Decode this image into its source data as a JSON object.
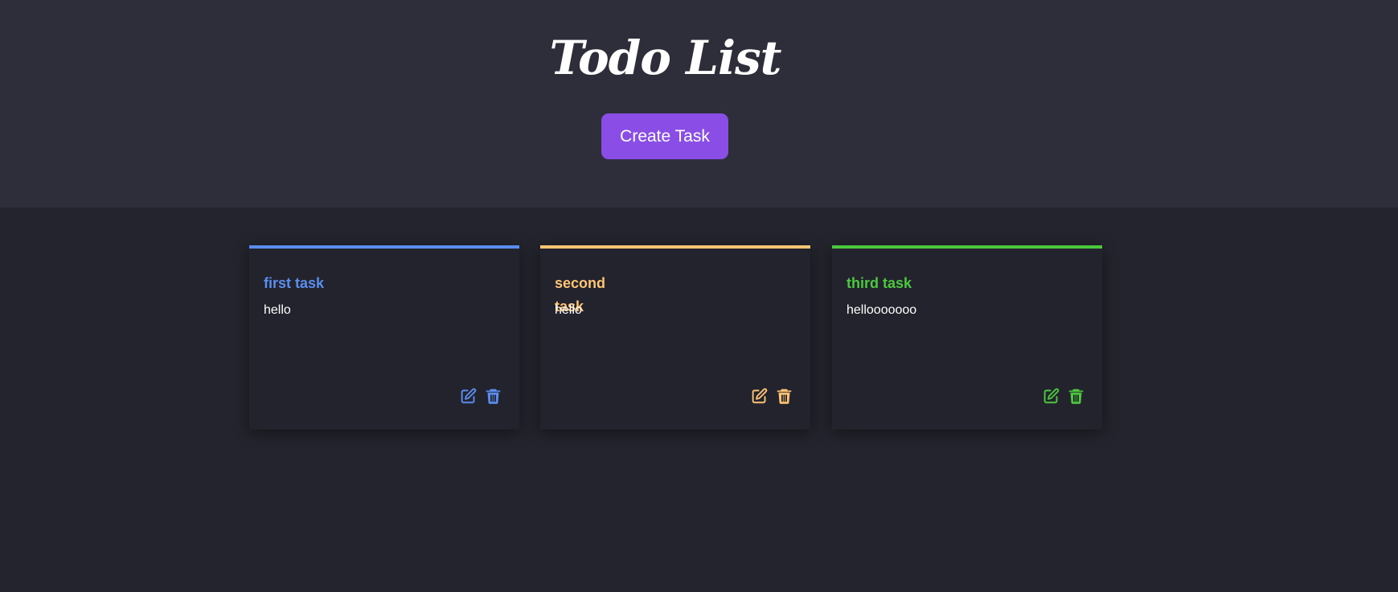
{
  "header": {
    "title": "Todo List",
    "create_button_label": "Create Task"
  },
  "tasks": [
    {
      "title": "first task",
      "description": "hello",
      "color": "#5b8def"
    },
    {
      "title": "second task",
      "description": "hello",
      "color": "#fdc474"
    },
    {
      "title": "third task",
      "description": "hellooooooo",
      "color": "#4cc83f"
    }
  ],
  "icons": {
    "edit": "edit-icon",
    "delete": "trash-icon"
  },
  "colors": {
    "header_bg": "#2e2e3a",
    "page_bg": "#24242e",
    "accent": "#8a4ee6"
  }
}
